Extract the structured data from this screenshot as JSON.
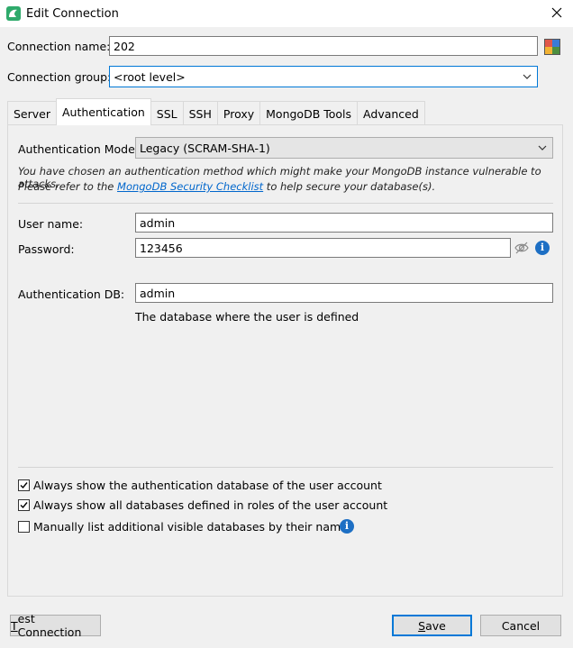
{
  "window": {
    "title": "Edit Connection"
  },
  "connection": {
    "name_label": "Connection name:",
    "name_value": "202",
    "group_label": "Connection group:",
    "group_value": "<root level>"
  },
  "tabs": [
    {
      "label": "Server",
      "active": false
    },
    {
      "label": "Authentication",
      "active": true
    },
    {
      "label": "SSL",
      "active": false
    },
    {
      "label": "SSH",
      "active": false
    },
    {
      "label": "Proxy",
      "active": false
    },
    {
      "label": "MongoDB Tools",
      "active": false
    },
    {
      "label": "Advanced",
      "active": false
    }
  ],
  "auth": {
    "mode_label": "Authentication Mode:",
    "mode_value": "Legacy (SCRAM-SHA-1)",
    "warning_line1": "You have chosen an authentication method which might make your MongoDB instance vulnerable to attacks.",
    "warning_line2_pre": "Please refer to the ",
    "warning_link": "MongoDB Security Checklist",
    "warning_line2_post": " to help secure your database(s).",
    "username_label": "User name:",
    "username_value": "admin",
    "password_label": "Password:",
    "password_value": "123456",
    "authdb_label": "Authentication DB:",
    "authdb_value": "admin",
    "authdb_hint": "The database where the user is defined"
  },
  "options": [
    {
      "label": "Always show the authentication database of the user account",
      "checked": true
    },
    {
      "label": "Always show all databases defined in roles of the user account",
      "checked": true
    },
    {
      "label": "Manually list additional visible databases by their names",
      "checked": false
    }
  ],
  "buttons": {
    "test_first": "T",
    "test_rest": "est Connection",
    "save_first": "S",
    "save_rest": "ave",
    "cancel": "Cancel"
  },
  "colors": {
    "app_icon": "#2eaa6b",
    "info": "#1d6fc4",
    "link": "#0066cc",
    "primary_border": "#0078d7"
  }
}
